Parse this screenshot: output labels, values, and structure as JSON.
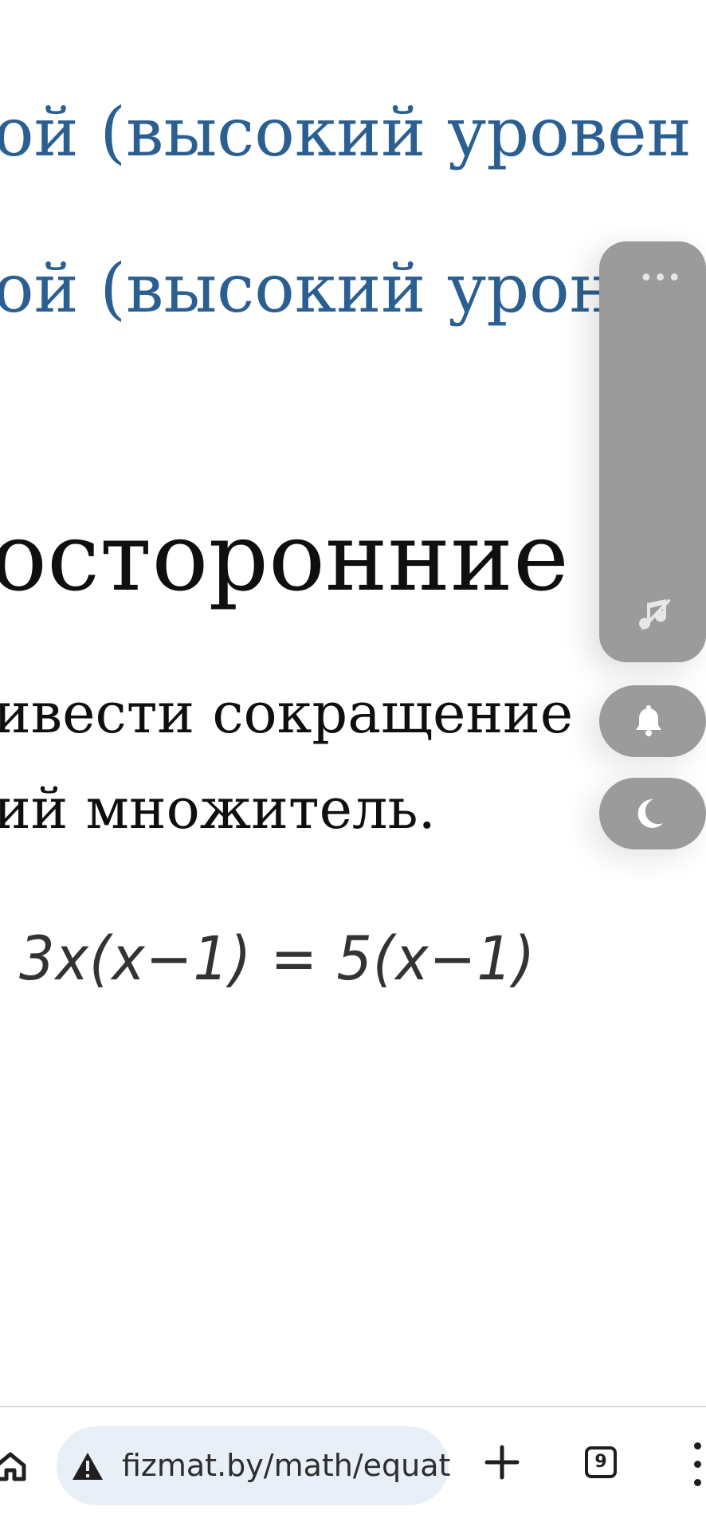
{
  "article": {
    "link_1": "ой (высокий уровен",
    "link_2": "ой (высокий урон",
    "heading": "осторонние к",
    "paragraph_line_1": "ивести сокращение",
    "paragraph_line_2": "ий множитель.",
    "equation": "3x(x−1) = 5(x−1)"
  },
  "floating_panel": {
    "menu_icon": "more-horizontal-icon",
    "music_icon": "music-off-icon",
    "bell_icon": "bell-icon",
    "moon_icon": "moon-icon"
  },
  "bottom_bar": {
    "address": "fizmat.by/math/equat",
    "tabs_count": "9",
    "home_icon": "home-icon",
    "warning_icon": "warning-icon",
    "plus_icon": "plus-icon",
    "more_icon": "more-vertical-icon"
  },
  "colors": {
    "link": "#2b5f91",
    "panel": "#9b9b9b",
    "address_pill": "#e8eff7"
  }
}
